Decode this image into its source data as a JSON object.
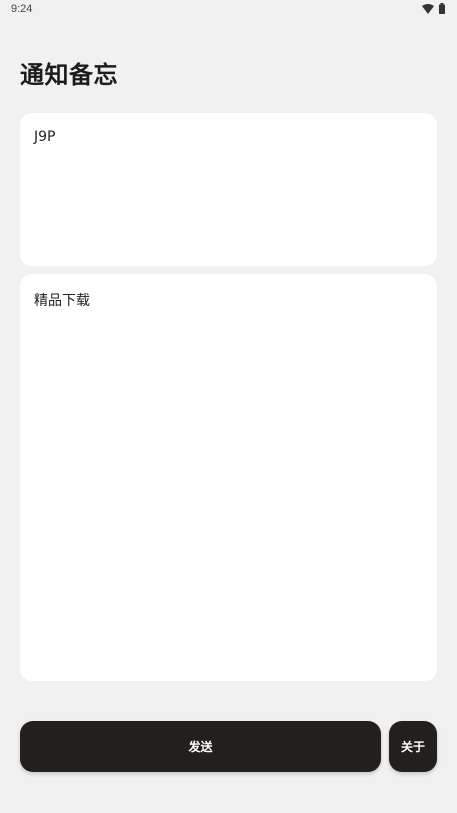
{
  "status_bar": {
    "time": "9:24",
    "icons": [
      "wifi-icon",
      "battery-icon"
    ]
  },
  "page": {
    "title": "通知备忘"
  },
  "form": {
    "title_value": "J9P",
    "content_value": "精品下载"
  },
  "actions": {
    "send_label": "发送",
    "about_label": "关于"
  },
  "colors": {
    "background": "#f1f1f1",
    "card": "#ffffff",
    "button": "#231f1d",
    "button_text": "#ffffff"
  }
}
